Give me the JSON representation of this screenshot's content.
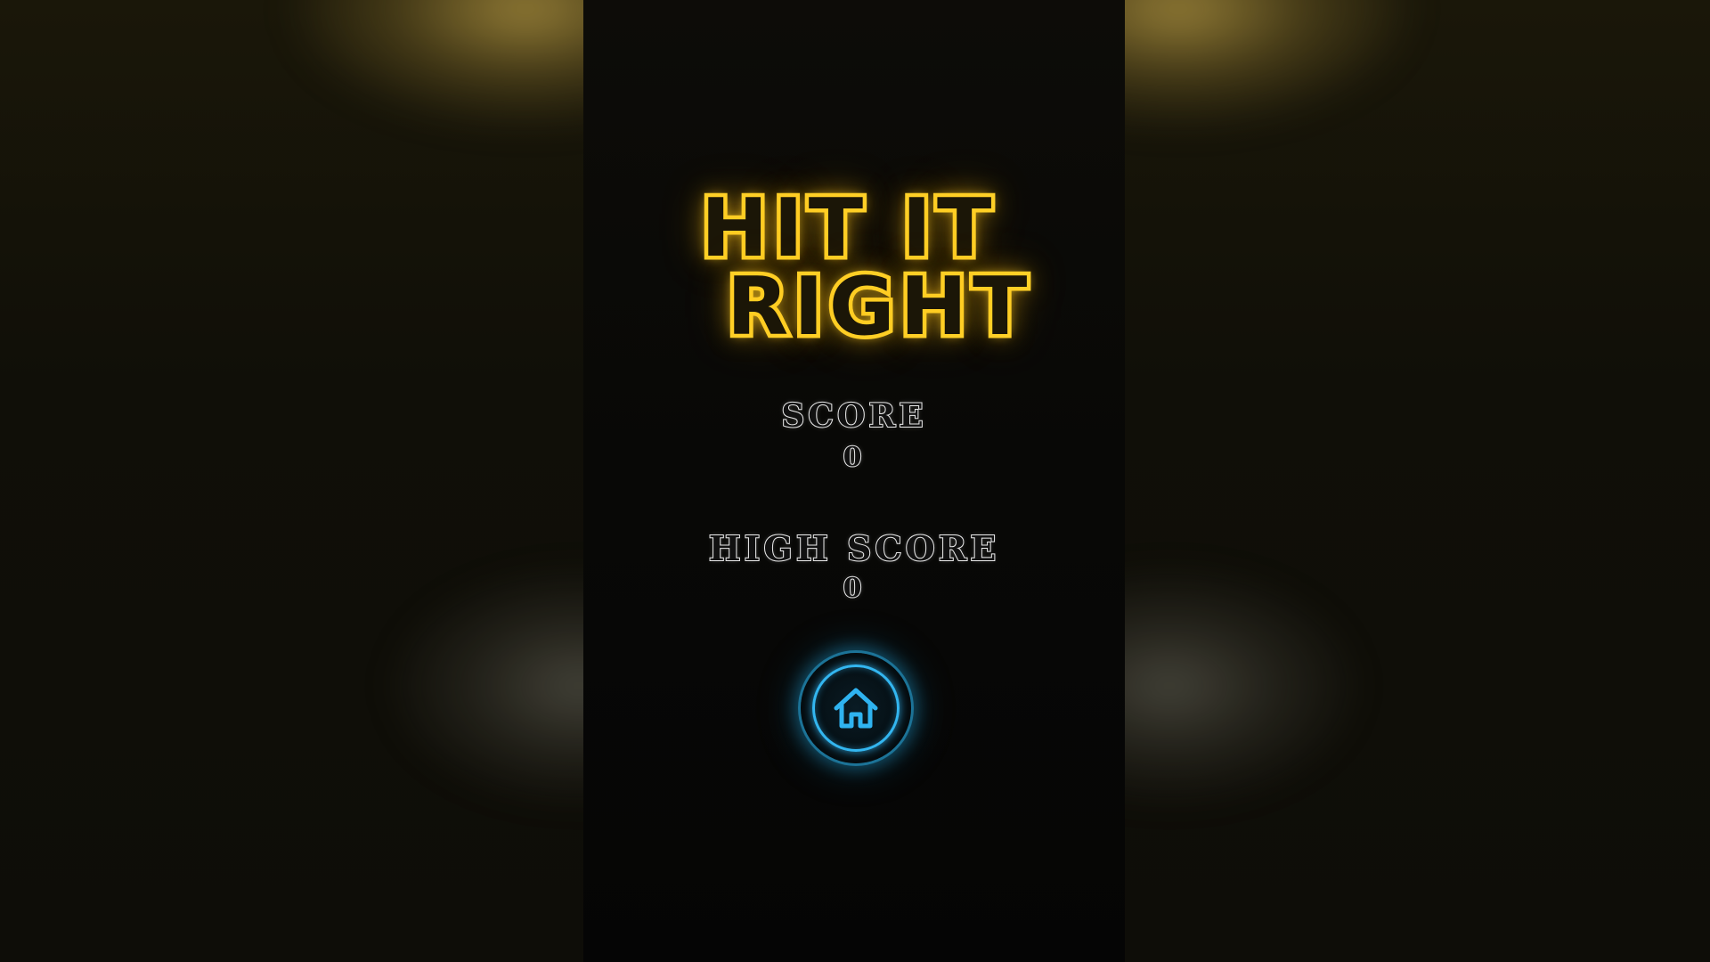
{
  "title": {
    "line1": "HIT IT",
    "line2": "RIGHT"
  },
  "score": {
    "label": "SCORE",
    "value": "0"
  },
  "high_score": {
    "label": "HIGH SCORE",
    "value": "0"
  },
  "buttons": {
    "home": {
      "icon": "home-icon"
    }
  },
  "colors": {
    "title_neon": "#ffd52e",
    "button_neon": "#33b6f0",
    "text_outline": "#e8e8e8"
  }
}
